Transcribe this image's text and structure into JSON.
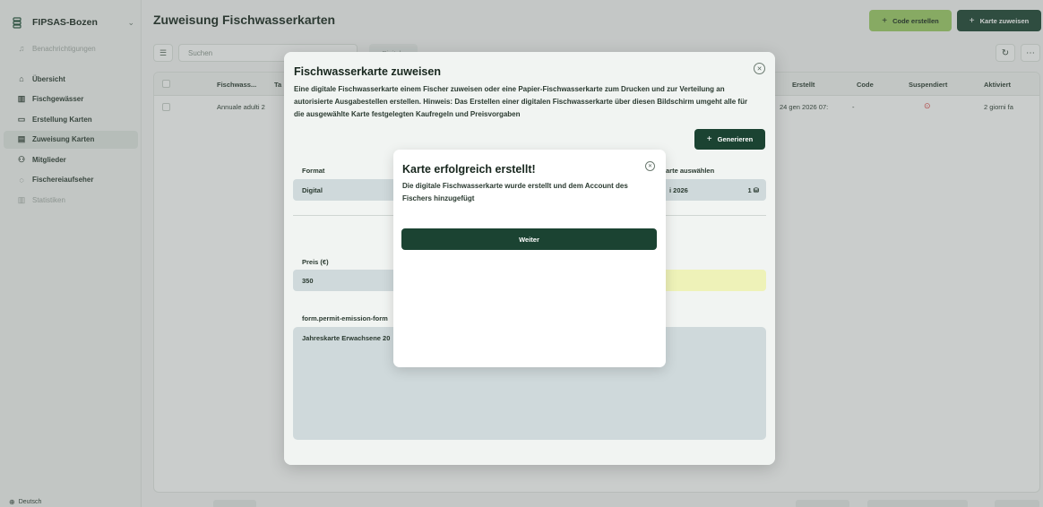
{
  "sidebar": {
    "org_name": "FIPSAS-Bozen",
    "notifications": "Benachrichtigungen",
    "items": [
      {
        "label": "Übersicht"
      },
      {
        "label": "Fischgewässer"
      },
      {
        "label": "Erstellung Karten"
      },
      {
        "label": "Zuweisung Karten"
      },
      {
        "label": "Mitglieder"
      },
      {
        "label": "Fischereiaufseher"
      },
      {
        "label": "Statistiken"
      }
    ],
    "language": "Deutsch"
  },
  "header": {
    "title": "Zuweisung Fischwasserkarten",
    "code_button": "Code erstellen",
    "assign_button": "Karte zuweisen"
  },
  "toolbar": {
    "search_placeholder": "Suchen",
    "chip_label": "Digitale"
  },
  "table": {
    "columns": {
      "col1": "Fischwass...",
      "col2": "Ta",
      "created": "Erstellt",
      "code": "Code",
      "suspended": "Suspendiert",
      "activated": "Aktiviert"
    },
    "rows": [
      {
        "name": "Annuale adulti 2",
        "created": "24 gen 2026 07:",
        "code": "-",
        "activated": "2 giorni fa"
      }
    ]
  },
  "modal": {
    "title": "Fischwasserkarte zuweisen",
    "description": "Eine digitale Fischwasserkarte einem Fischer zuweisen oder eine Papier-Fischwasserkarte zum Drucken und zur Verteilung an autorisierte Ausgabestellen erstellen. Hinweis: Das Erstellen einer digitalen Fischwasserkarte über diesen Bildschirm umgeht alle für die ausgewählte Karte festgelegten Kaufregeln und Preisvorgaben",
    "generate_button": "Generieren",
    "format_label": "Format",
    "format_value": "Digital",
    "card_label": "arte auswählen",
    "card_value": "i 2026",
    "card_count": "1",
    "price_label": "Preis (€)",
    "price_value": "350",
    "form_label": "form.permit-emission-form",
    "form_value": "Jahreskarte Erwachsene 20"
  },
  "success": {
    "title": "Karte erfolgreich erstellt!",
    "message": "Die digitale Fischwasserkarte wurde erstellt und dem Account des Fischers hinzugefügt",
    "continue_button": "Weiter"
  }
}
